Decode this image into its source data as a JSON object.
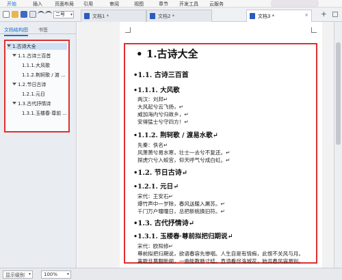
{
  "ribbon": {
    "tabs": [
      "开始",
      "插入",
      "页面布局",
      "引用",
      "审阅",
      "视图",
      "章节",
      "开发工具",
      "云服务"
    ],
    "active_tab": "开始"
  },
  "toolbar": {
    "font_size": "二号"
  },
  "doc_tabs": [
    {
      "label": "文档1 *"
    },
    {
      "label": "文档2 *"
    },
    {
      "label": "文档3 *"
    }
  ],
  "left_panel": {
    "tabs": [
      "文档结构图",
      "书签"
    ],
    "outline": [
      {
        "label": "1.古诗大全"
      },
      {
        "label": "1.1.古诗三百首"
      },
      {
        "label": "1.1.1.大风歌"
      },
      {
        "label": "1.1.2.荆轲歌 / 渡 ..."
      },
      {
        "label": "1.2.节日古诗"
      },
      {
        "label": "1.2.1.元日"
      },
      {
        "label": "1.3.古代抒情诗"
      },
      {
        "label": "1.3.1.玉楼春·尊前 ..."
      }
    ]
  },
  "document": {
    "h1": "1.古诗大全",
    "s1": "1.1. 古诗三百首",
    "s1_1": "1.1.1. 大风歌",
    "p1": [
      "两汉：刘邦↵",
      "大风起兮云飞扬，↵",
      "威加海内兮归故乡，↵",
      "安得猛士兮守四方！↵"
    ],
    "s1_2": "1.1.2. 荆轲歌 / 渡易水歌↵",
    "p2": [
      "先秦：佚名↵",
      "风萧萧兮易水寒，壮士一去兮不复还。↵",
      "探虎穴兮入蛟宫，仰天呼气兮成白虹。↵"
    ],
    "s2": "1.2. 节日古诗↵",
    "s2_1": "1.2.1. 元日↵",
    "p3": [
      "宋代：王安石↵",
      "爆竹声中一岁除，春风送暖入屠苏。↵",
      "千门万户曈曈日，总把新桃换旧符。↵"
    ],
    "s3": "1.3. 古代抒情诗↵",
    "s3_1": "1.3.1. 玉楼春·尊前拟把归期说↵",
    "p4": [
      "宋代：欧阳修↵",
      "尊前拟把归期说，欲语春容先惨咽。人生自是有情痴，此恨不关风与月。",
      "离歌且莫翻新阕，一曲能教肠寸结。直须看尽洛城花，始共春风容易别。"
    ]
  },
  "status": {
    "outline_level": "显示级别",
    "zoom": "100%"
  },
  "colors": {
    "accent": "#1a6ec8",
    "highlight_red": "#e02d2d"
  }
}
